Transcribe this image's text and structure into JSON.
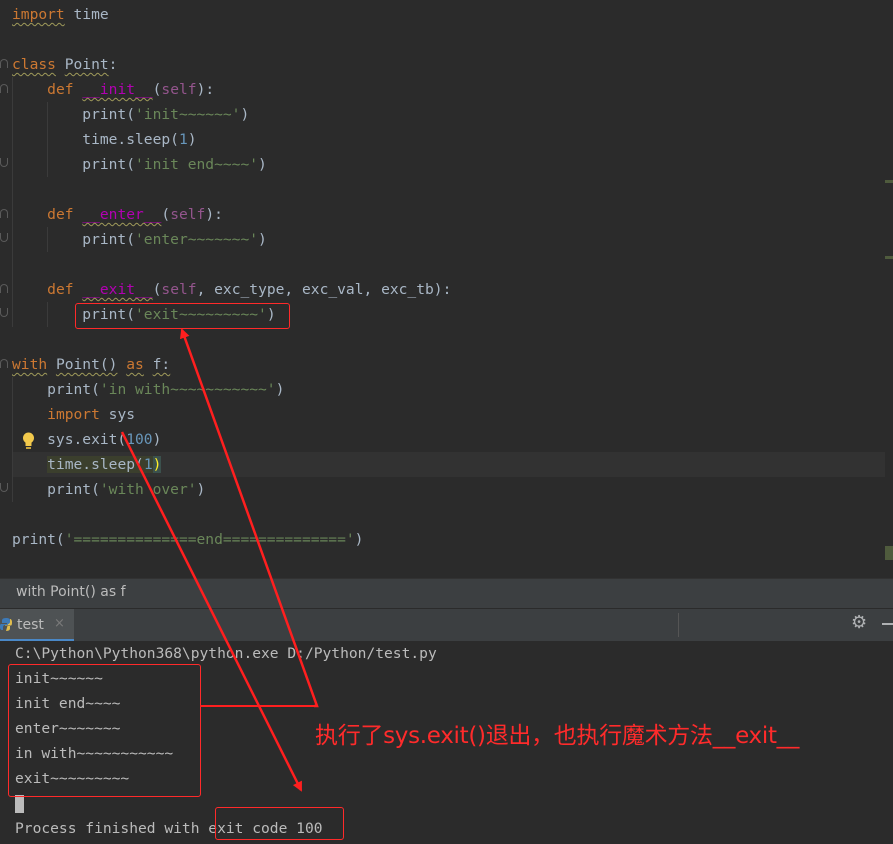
{
  "editor": {
    "lines": [
      {
        "segments": [
          {
            "t": "import",
            "c": "kw u-warn"
          },
          {
            "t": " time",
            "c": ""
          }
        ]
      },
      {
        "segments": []
      },
      {
        "segments": [
          {
            "t": "class",
            "c": "kw u-warn"
          },
          {
            "t": " ",
            "c": ""
          },
          {
            "t": "Point",
            "c": "u-warn"
          },
          {
            "t": ":",
            "c": ""
          }
        ]
      },
      {
        "segments": [
          {
            "t": "    ",
            "c": ""
          },
          {
            "t": "def",
            "c": "kw"
          },
          {
            "t": " ",
            "c": ""
          },
          {
            "t": "__init__",
            "c": "fn u-warn"
          },
          {
            "t": "(",
            "c": ""
          },
          {
            "t": "self",
            "c": "self"
          },
          {
            "t": "):",
            "c": ""
          }
        ]
      },
      {
        "segments": [
          {
            "t": "        print(",
            "c": ""
          },
          {
            "t": "'init~~~~~~'",
            "c": "str"
          },
          {
            "t": ")",
            "c": ""
          }
        ]
      },
      {
        "segments": [
          {
            "t": "        time.sleep(",
            "c": ""
          },
          {
            "t": "1",
            "c": "num"
          },
          {
            "t": ")",
            "c": ""
          }
        ]
      },
      {
        "segments": [
          {
            "t": "        print(",
            "c": ""
          },
          {
            "t": "'init end~~~~'",
            "c": "str"
          },
          {
            "t": ")",
            "c": ""
          }
        ]
      },
      {
        "segments": []
      },
      {
        "segments": [
          {
            "t": "    ",
            "c": ""
          },
          {
            "t": "def",
            "c": "kw"
          },
          {
            "t": " ",
            "c": ""
          },
          {
            "t": "__enter__",
            "c": "fn u-warn"
          },
          {
            "t": "(",
            "c": ""
          },
          {
            "t": "self",
            "c": "self"
          },
          {
            "t": "):",
            "c": ""
          }
        ]
      },
      {
        "segments": [
          {
            "t": "        print(",
            "c": ""
          },
          {
            "t": "'enter~~~~~~~'",
            "c": "str"
          },
          {
            "t": ")",
            "c": ""
          }
        ]
      },
      {
        "segments": []
      },
      {
        "segments": [
          {
            "t": "    ",
            "c": ""
          },
          {
            "t": "def",
            "c": "kw"
          },
          {
            "t": " ",
            "c": ""
          },
          {
            "t": "__exit__",
            "c": "fn u-warn"
          },
          {
            "t": "(",
            "c": ""
          },
          {
            "t": "self",
            "c": "self"
          },
          {
            "t": ", exc_type, exc_val, exc_tb):",
            "c": ""
          }
        ]
      },
      {
        "segments": [
          {
            "t": "        print(",
            "c": ""
          },
          {
            "t": "'exit~~~~~~~~~'",
            "c": "str"
          },
          {
            "t": ")",
            "c": ""
          }
        ]
      },
      {
        "segments": []
      },
      {
        "segments": [
          {
            "t": "with",
            "c": "kw u-warn"
          },
          {
            "t": " ",
            "c": ""
          },
          {
            "t": "Point()",
            "c": "u-warn"
          },
          {
            "t": " ",
            "c": ""
          },
          {
            "t": "as",
            "c": "kw u-warn"
          },
          {
            "t": " ",
            "c": ""
          },
          {
            "t": "f:",
            "c": "u-warn"
          }
        ]
      },
      {
        "segments": [
          {
            "t": "    print(",
            "c": ""
          },
          {
            "t": "'in with~~~~~~~~~~~'",
            "c": "str"
          },
          {
            "t": ")",
            "c": ""
          }
        ]
      },
      {
        "segments": [
          {
            "t": "    ",
            "c": ""
          },
          {
            "t": "import",
            "c": "kw"
          },
          {
            "t": " sys",
            "c": ""
          }
        ]
      },
      {
        "segments": [
          {
            "t": "    sys.exit(",
            "c": ""
          },
          {
            "t": "100",
            "c": "num"
          },
          {
            "t": ")",
            "c": ""
          }
        ]
      },
      {
        "segments": [
          {
            "t": "    ",
            "c": ""
          },
          {
            "t": "time.sleep(",
            "c": "hl-yellow"
          },
          {
            "t": "1",
            "c": "num hl-yellow"
          },
          {
            "t": ")",
            "c": "bracket-match"
          }
        ]
      },
      {
        "segments": [
          {
            "t": "    print(",
            "c": ""
          },
          {
            "t": "'with over'",
            "c": "str"
          },
          {
            "t": ")",
            "c": ""
          }
        ]
      },
      {
        "segments": []
      },
      {
        "segments": [
          {
            "t": "print(",
            "c": ""
          },
          {
            "t": "'==============end=============='",
            "c": "str"
          },
          {
            "t": ")",
            "c": ""
          }
        ]
      }
    ]
  },
  "breadcrumb": {
    "text": "with Point() as f"
  },
  "run": {
    "tab_label": "test",
    "tab_close": "×",
    "gear_icon": "settings-gear",
    "gear_glyph": "⚙"
  },
  "console": {
    "command": "C:\\Python\\Python368\\python.exe D:/Python/test.py",
    "outputs": [
      "init~~~~~~",
      "init end~~~~",
      "enter~~~~~~~",
      "in with~~~~~~~~~~~",
      "exit~~~~~~~~~"
    ],
    "finished": "Process finished with exit code 100"
  },
  "annotation": {
    "text": "执行了sys.exit()退出，也执行魔术方法__exit__",
    "color": "#ff2b2b"
  },
  "colors": {
    "editor_bg": "#2b2b2b",
    "keyword": "#cc7832",
    "string": "#6a8759",
    "number": "#6897bb",
    "dunder": "#b200b2",
    "self": "#94558d",
    "default": "#a9b7c6",
    "accent": "#4a88c7"
  }
}
